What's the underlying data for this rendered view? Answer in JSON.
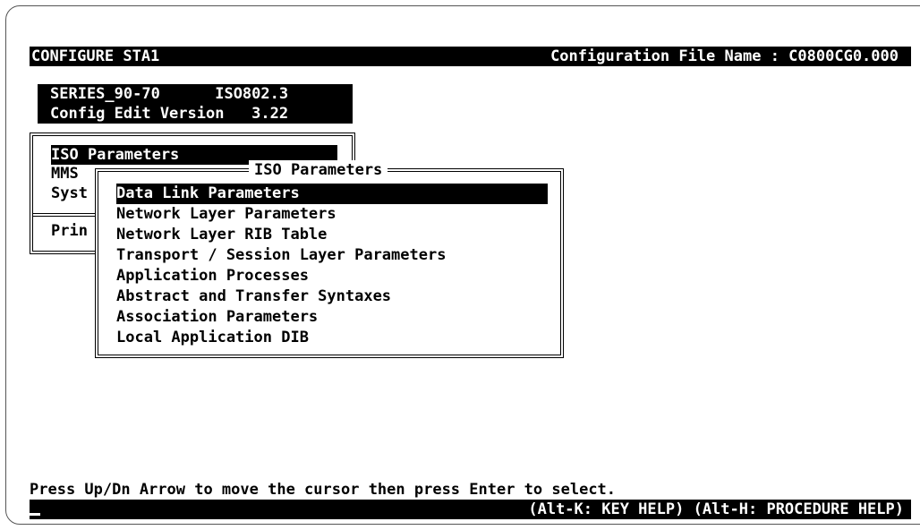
{
  "header": {
    "left": "CONFIGURE STA1",
    "right": "Configuration File Name : C0800CG0.000"
  },
  "info": {
    "line1": "SERIES_90-70      ISO802.3",
    "line2": "Config Edit Version   3.22"
  },
  "main_menu": {
    "items": [
      "ISO Parameters",
      "MMS",
      "Syst"
    ],
    "print_item": "Prin"
  },
  "submenu": {
    "title": "ISO Parameters",
    "items": [
      "Data Link Parameters",
      "Network Layer Parameters",
      "Network Layer RIB Table",
      "Transport / Session Layer Parameters",
      "Application Processes",
      "Abstract and Transfer Syntaxes",
      "Association Parameters",
      "Local Application DIB"
    ]
  },
  "footer": {
    "prompt": "Press Up/Dn Arrow to move the cursor then press Enter to select.",
    "help": "(Alt-K: KEY HELP) (Alt-H: PROCEDURE HELP)"
  },
  "colors": {
    "background": "#ffffff",
    "foreground": "#000000"
  }
}
